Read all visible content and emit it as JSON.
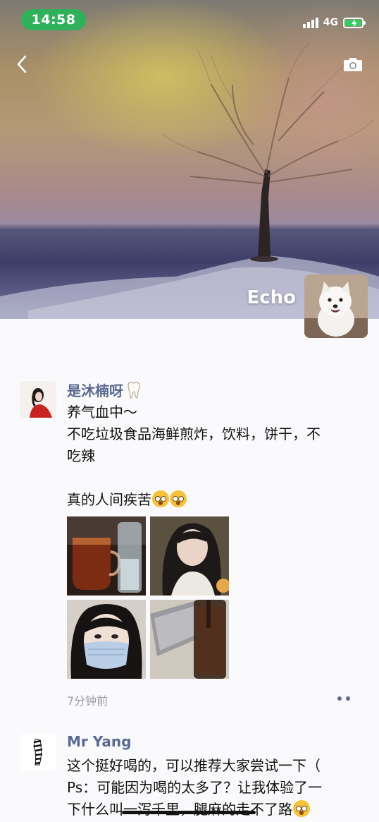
{
  "status_bar": {
    "time": "14:58",
    "network": "4G",
    "icons": [
      "signal-icon",
      "battery-charging-icon"
    ]
  },
  "header": {
    "icons": [
      "back-chevron-icon",
      "camera-icon"
    ]
  },
  "profile": {
    "name": "Echo",
    "avatar_icon": "dog-avatar"
  },
  "posts": [
    {
      "username": "是沐楠呀",
      "username_icon": "tooth-icon",
      "lines": [
        "养气血中～",
        "不吃垃圾食品海鲜煎炸，饮料，饼干，不",
        "吃辣",
        "",
        "真的人间疾苦"
      ],
      "photos": [
        "drinks-photo",
        "selfie-photo",
        "masked-selfie-photo",
        "laptop-drink-photo"
      ],
      "time": "7分钟前"
    },
    {
      "username": "Mr Yang",
      "lines": [
        "这个挺好喝的，可以推荐大家尝试一下（",
        "Ps：可能因为喝的太多了？让我体验了一",
        "下什么叫一泻千里，腿麻的走不了路"
      ]
    }
  ],
  "colors": {
    "accent_name": "#5b6a92",
    "status_green": "#2fb15b",
    "background": "#fafafc"
  }
}
